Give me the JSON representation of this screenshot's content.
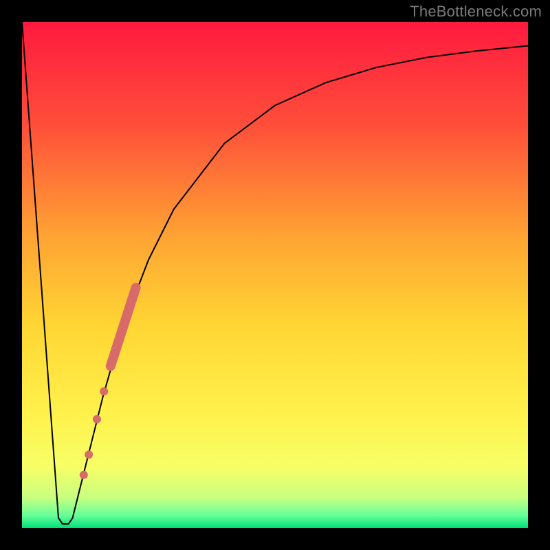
{
  "watermark": "TheBottleneck.com",
  "chart_data": {
    "type": "line",
    "title": "",
    "xlabel": "",
    "ylabel": "",
    "xlim": [
      0,
      100
    ],
    "ylim": [
      0,
      100
    ],
    "grid": false,
    "background_gradient": {
      "orientation": "vertical",
      "stops": [
        {
          "pos": 0.0,
          "color": "#ff1a3f"
        },
        {
          "pos": 0.2,
          "color": "#ff4d3a"
        },
        {
          "pos": 0.42,
          "color": "#ffa233"
        },
        {
          "pos": 0.6,
          "color": "#ffd633"
        },
        {
          "pos": 0.78,
          "color": "#fff24d"
        },
        {
          "pos": 0.88,
          "color": "#f6ff66"
        },
        {
          "pos": 0.94,
          "color": "#c8ff80"
        },
        {
          "pos": 0.975,
          "color": "#66ff99"
        },
        {
          "pos": 1.0,
          "color": "#00e07a"
        }
      ]
    },
    "series": [
      {
        "name": "bottleneck-curve",
        "stroke": "#000000",
        "stroke_width": 2,
        "points": [
          {
            "x": 0.0,
            "y": 100.0
          },
          {
            "x": 7.2,
            "y": 2.0
          },
          {
            "x": 8.0,
            "y": 0.8
          },
          {
            "x": 9.2,
            "y": 0.8
          },
          {
            "x": 10.0,
            "y": 2.0
          },
          {
            "x": 12.0,
            "y": 10.0
          },
          {
            "x": 16.0,
            "y": 26.0
          },
          {
            "x": 20.0,
            "y": 40.0
          },
          {
            "x": 25.0,
            "y": 53.0
          },
          {
            "x": 30.0,
            "y": 63.0
          },
          {
            "x": 40.0,
            "y": 76.0
          },
          {
            "x": 50.0,
            "y": 83.5
          },
          {
            "x": 60.0,
            "y": 88.0
          },
          {
            "x": 70.0,
            "y": 91.0
          },
          {
            "x": 80.0,
            "y": 93.0
          },
          {
            "x": 90.0,
            "y": 94.3
          },
          {
            "x": 100.0,
            "y": 95.3
          }
        ]
      }
    ],
    "markers": {
      "color": "#d86a6a",
      "thick_segment": {
        "comment": "wide rounded segment along curve",
        "from": {
          "x": 17.5,
          "y": 32.0
        },
        "to": {
          "x": 22.5,
          "y": 47.5
        },
        "width": 14
      },
      "dots": [
        {
          "x": 16.2,
          "y": 27.0,
          "r": 6
        },
        {
          "x": 14.8,
          "y": 21.5,
          "r": 6
        },
        {
          "x": 13.2,
          "y": 14.5,
          "r": 6
        },
        {
          "x": 12.2,
          "y": 10.5,
          "r": 6
        }
      ]
    }
  }
}
